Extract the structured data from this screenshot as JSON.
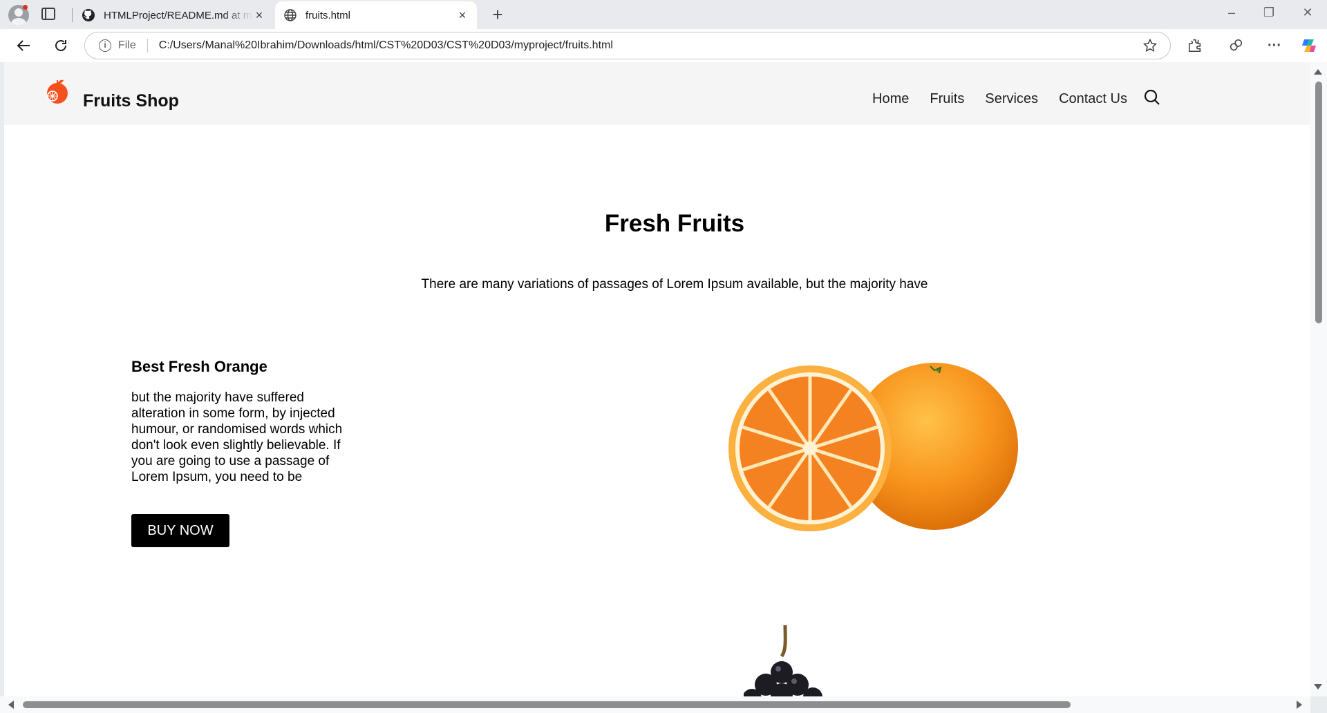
{
  "browser": {
    "tabs": [
      {
        "title": "HTMLProject/README.md at main · Manal",
        "favicon": "github-icon",
        "active": false
      },
      {
        "title": "fruits.html",
        "favicon": "globe-icon",
        "active": true
      }
    ],
    "address": {
      "scheme": "File",
      "url": "C:/Users/Manal%20Ibrahim/Downloads/html/CST%20D03/CST%20D03/myproject/fruits.html"
    }
  },
  "site": {
    "brand": "Fruits Shop",
    "nav": [
      "Home",
      "Fruits",
      "Services",
      "Contact Us"
    ],
    "hero": {
      "title": "Fresh Fruits",
      "subtitle": "There are many variations of passages of Lorem Ipsum available, but the majority have"
    },
    "product": {
      "title": "Best Fresh Orange",
      "description": "but the majority have suffered alteration in some form, by injected humour, or randomised words which don't look even slightly believable. If you are going to use a passage of Lorem Ipsum, you need to be",
      "button": "BUY NOW"
    }
  },
  "colors": {
    "accent": "#000000",
    "header_bg": "#f5f5f5",
    "logo": "#f4511e",
    "orange": "#f7941d"
  }
}
